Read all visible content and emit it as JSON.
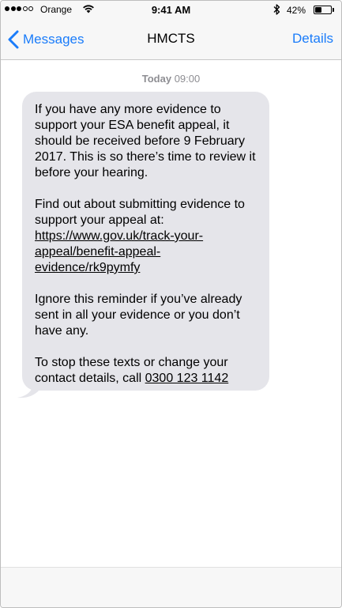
{
  "status_bar": {
    "carrier": "Orange",
    "time": "9:41 AM",
    "battery": "42%",
    "battery_level": 0.42,
    "signal_bars_filled": 3,
    "signal_bars_total": 5
  },
  "nav": {
    "back_label": "Messages",
    "title": "HMCTS",
    "details_label": "Details"
  },
  "timestamp": {
    "day": "Today",
    "time": "09:00"
  },
  "message": {
    "paragraph_1": "If you have any more evidence to support your ESA benefit appeal, it should be received before 9 February 2017. This is so there’s time to review it before your hearing.",
    "paragraph_2_text": "Find out about submitting evidence to support your appeal at: ",
    "paragraph_2_link": "https://www.gov.uk/track-your-appeal/benefit-appeal-evidence/rk9pymfy",
    "paragraph_3": "Ignore this reminder if you’ve already sent in all your evidence or you don’t have any.",
    "paragraph_4_text": "To stop these texts or change your contact details, call ",
    "paragraph_4_phone": "0300 123 1142"
  },
  "colors": {
    "accent": "#1a7cfa",
    "bubble": "#e5e5ea",
    "bar_background": "#f7f7f7",
    "timestamp": "#8e8e93"
  },
  "icons": {
    "back": "chevron-left-icon",
    "wifi": "wifi-icon",
    "bluetooth": "bluetooth-icon",
    "battery": "battery-icon"
  }
}
